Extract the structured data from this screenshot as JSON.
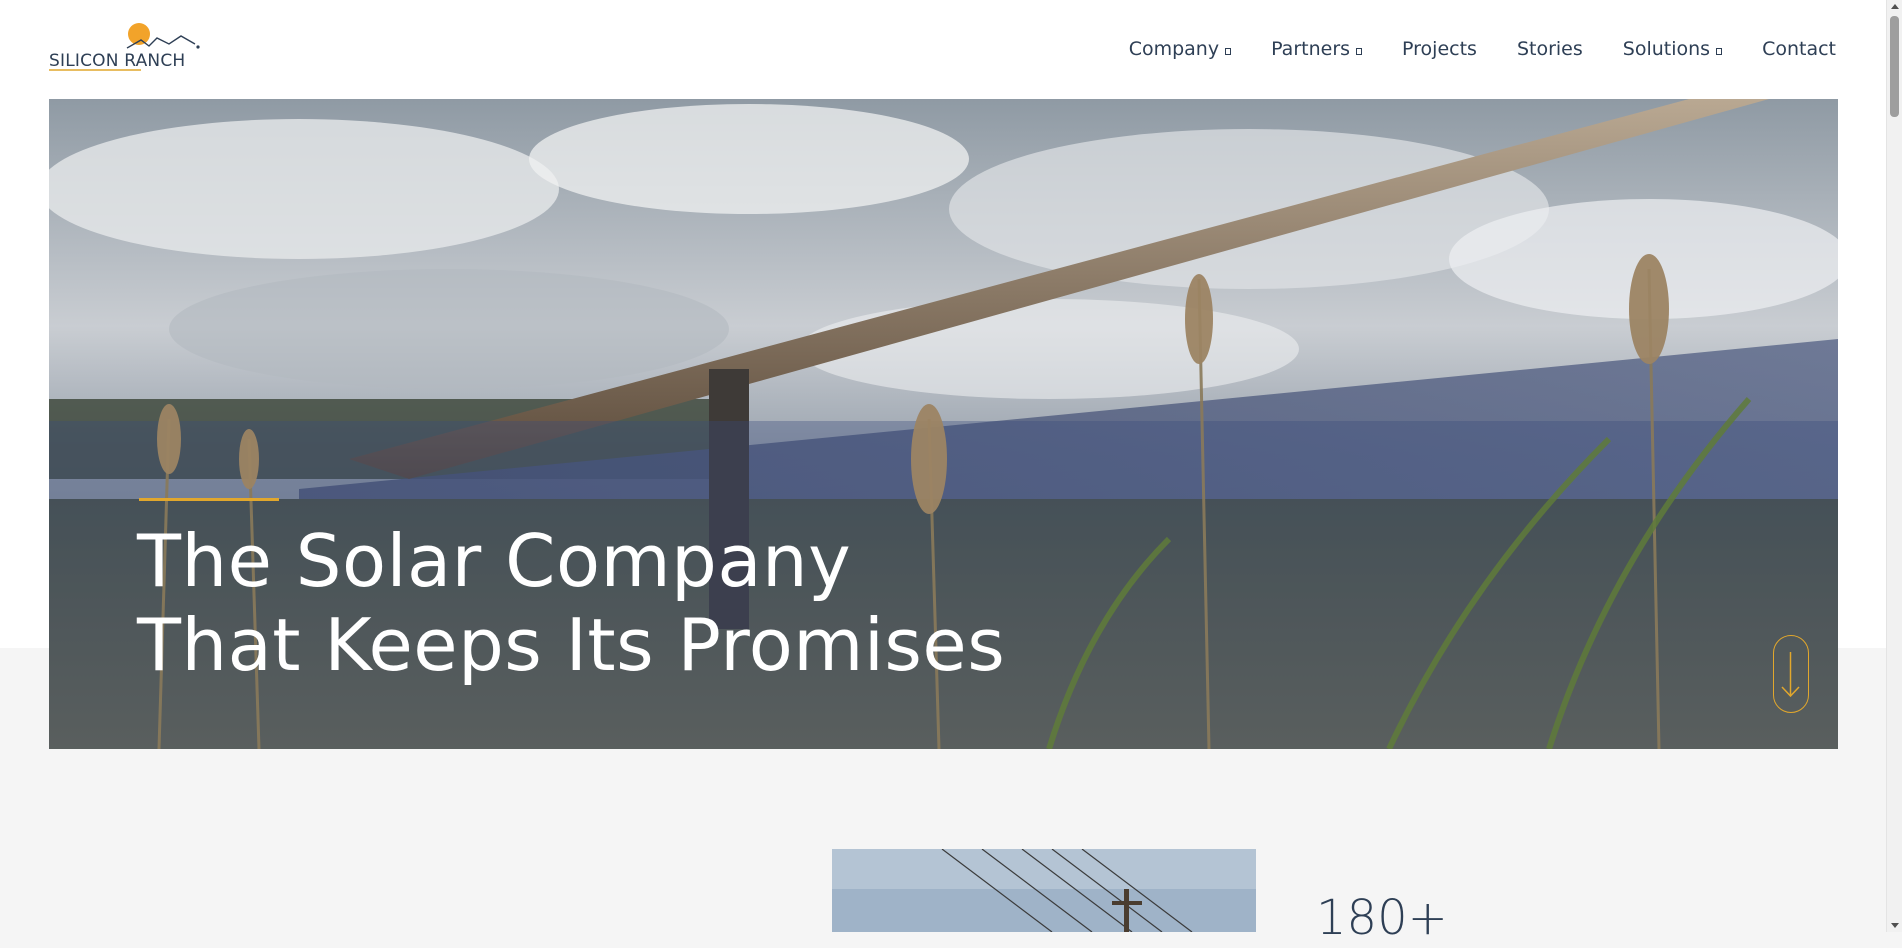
{
  "brand": {
    "logo_text": "SILICON RANCH",
    "logo_icon": "sun-over-mountains-icon",
    "accent_color": "#e1a72d",
    "text_color": "#2e3f55"
  },
  "nav": {
    "items": [
      {
        "label": "Company",
        "has_dropdown": true
      },
      {
        "label": "Partners",
        "has_dropdown": true
      },
      {
        "label": "Projects",
        "has_dropdown": false
      },
      {
        "label": "Stories",
        "has_dropdown": false
      },
      {
        "label": "Solutions",
        "has_dropdown": true
      },
      {
        "label": "Contact",
        "has_dropdown": false
      }
    ]
  },
  "hero": {
    "title_line1": "The Solar Company",
    "title_line2": "That Keeps Its Promises",
    "scroll_icon": "arrow-down-icon",
    "image": "solar-panels-grass-field"
  },
  "stats": {
    "first_value": "180+",
    "image": "power-line-pole-sky"
  }
}
